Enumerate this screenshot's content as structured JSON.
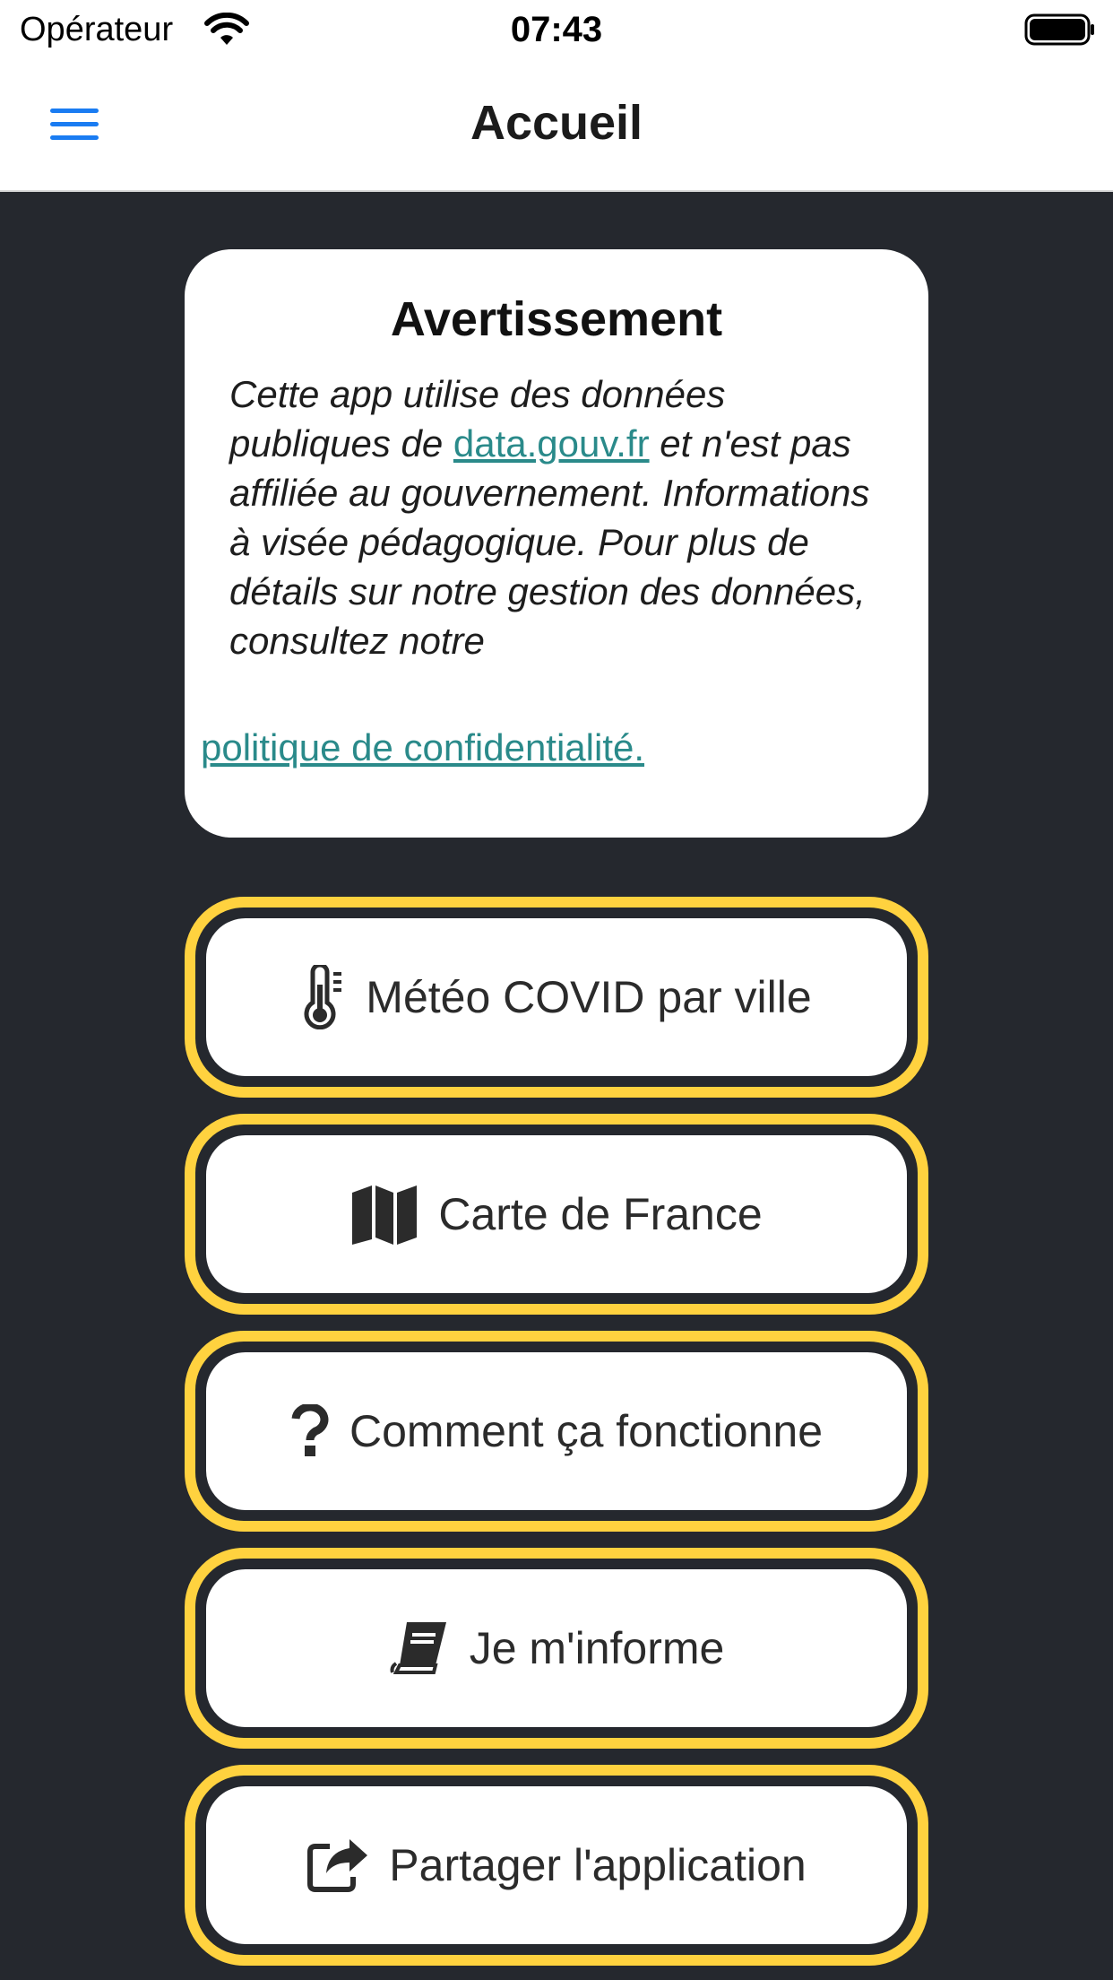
{
  "status_bar": {
    "carrier": "Opérateur",
    "time": "07:43"
  },
  "nav": {
    "title": "Accueil",
    "menu_icon": "hamburger-menu-icon",
    "accent_color": "#1a7cf2"
  },
  "warning": {
    "title": "Avertissement",
    "text_before_link": "Cette app utilise des données publiques de ",
    "data_link": "data.gouv.fr",
    "text_after_link": " et n'est pas affiliée au gouvernement. Informations à visée pédagogique. Pour plus de détails sur notre gestion des données, consultez notre",
    "policy_link": "politique de confidentialité.",
    "link_color": "#2a8a8a"
  },
  "menu": {
    "border_color": "#ffd23f",
    "items": [
      {
        "label": "Météo COVID par ville",
        "icon": "thermometer-icon"
      },
      {
        "label": "Carte de France",
        "icon": "map-icon"
      },
      {
        "label": "Comment ça fonctionne",
        "icon": "question-icon"
      },
      {
        "label": "Je m'informe",
        "icon": "book-icon"
      },
      {
        "label": "Partager l'application",
        "icon": "share-icon"
      }
    ]
  }
}
